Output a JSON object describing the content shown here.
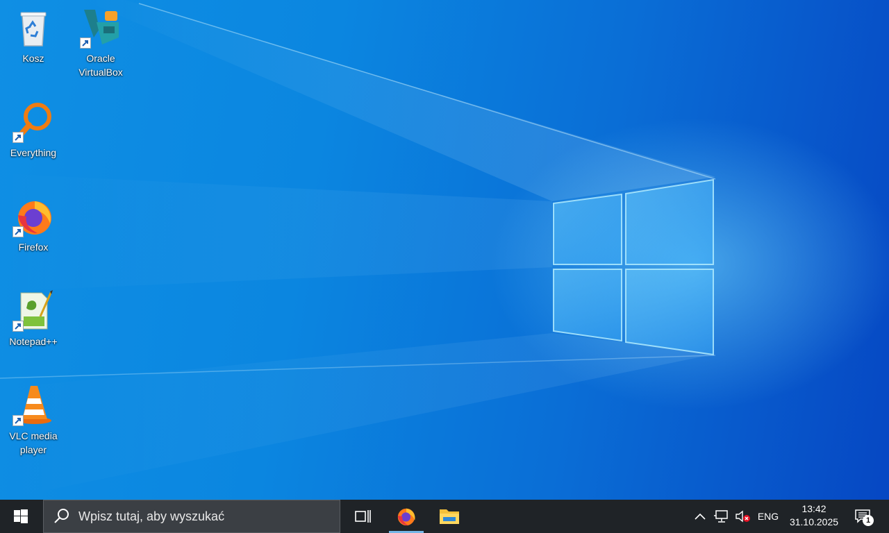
{
  "desktop": {
    "icons": [
      {
        "label": "Kosz",
        "icon": "recycle-bin-icon",
        "shortcut": false
      },
      {
        "label": "Oracle\nVirtualBox",
        "icon": "virtualbox-icon",
        "shortcut": true
      },
      {
        "label": "Everything",
        "icon": "everything-search-icon",
        "shortcut": true
      },
      {
        "label": "Firefox",
        "icon": "firefox-icon",
        "shortcut": true
      },
      {
        "label": "Notepad++",
        "icon": "notepad-plus-plus-icon",
        "shortcut": true
      },
      {
        "label": "VLC media\nplayer",
        "icon": "vlc-cone-icon",
        "shortcut": true
      }
    ]
  },
  "taskbar": {
    "start_icon": "windows-start-icon",
    "search_placeholder": "Wpisz tutaj, aby wyszukać",
    "pinned": [
      {
        "name": "Firefox",
        "icon": "firefox-icon",
        "active": true
      },
      {
        "name": "File Explorer",
        "icon": "folder-icon",
        "active": false
      }
    ],
    "tray": {
      "language": "ENG",
      "time": "13:42",
      "date": "31.10.2025",
      "notification_count": "1"
    }
  },
  "colors": {
    "taskbar_bg": "#1f2327",
    "accent": "#75b6e7",
    "wallpaper_blue": "#0b86e0"
  }
}
